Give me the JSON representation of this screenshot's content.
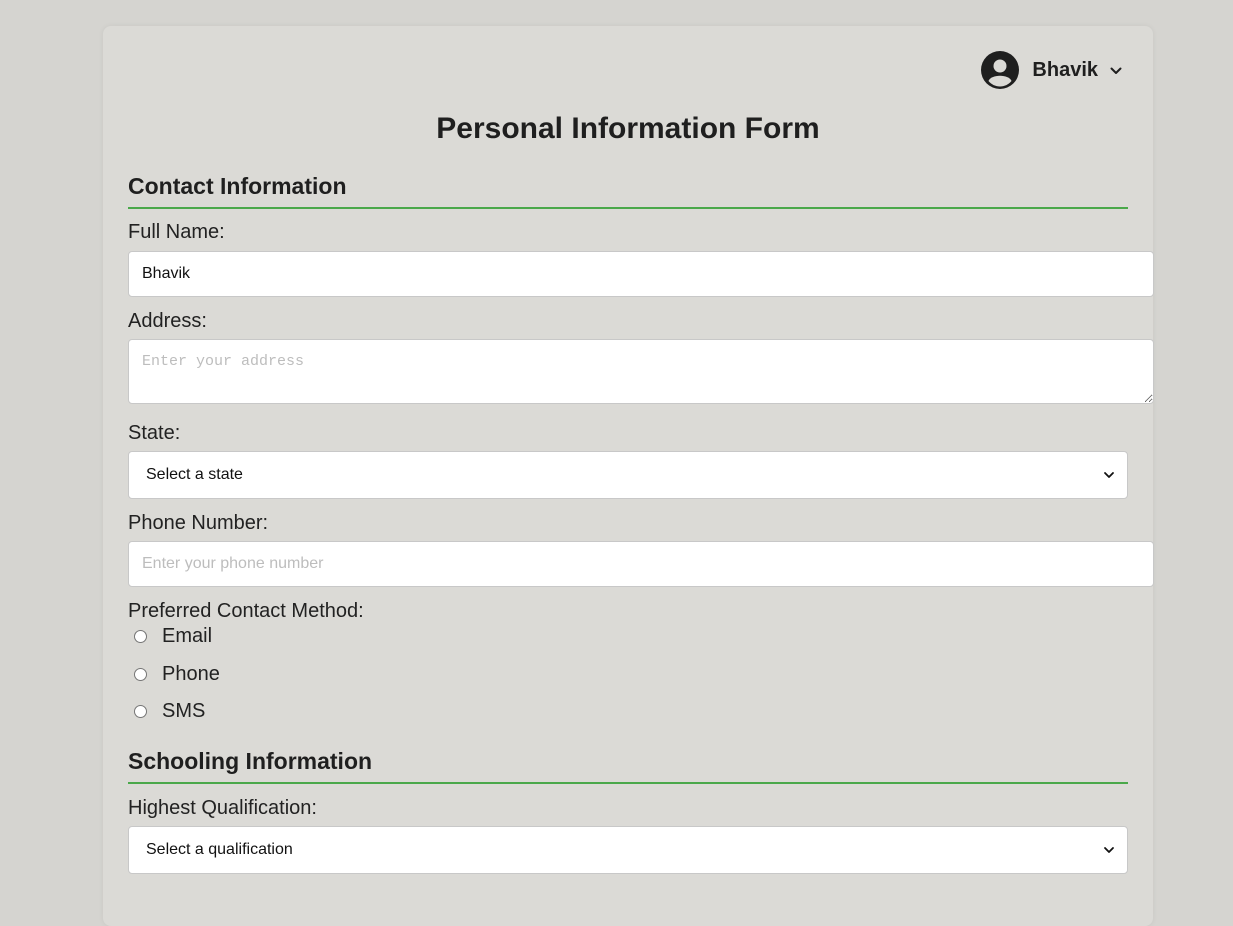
{
  "header": {
    "user_name": "Bhavik"
  },
  "form": {
    "title": "Personal Information Form"
  },
  "contact": {
    "section_title": "Contact Information",
    "full_name_label": "Full Name:",
    "full_name_value": "Bhavik",
    "address_label": "Address:",
    "address_placeholder": "Enter your address",
    "state_label": "State:",
    "state_selected": "Select a state",
    "phone_label": "Phone Number:",
    "phone_placeholder": "Enter your phone number",
    "contact_method_label": "Preferred Contact Method:",
    "contact_methods": [
      "Email",
      "Phone",
      "SMS"
    ]
  },
  "schooling": {
    "section_title": "Schooling Information",
    "qualification_label": "Highest Qualification:",
    "qualification_selected": "Select a qualification"
  },
  "colors": {
    "page_background": "#d5d4d0",
    "card_background": "#dbdad6",
    "section_rule": "#4aa84a"
  },
  "icons": {
    "avatar": "user-circle-icon",
    "user_menu": "chevron-down-icon",
    "select_caret": "chevron-down-icon"
  }
}
